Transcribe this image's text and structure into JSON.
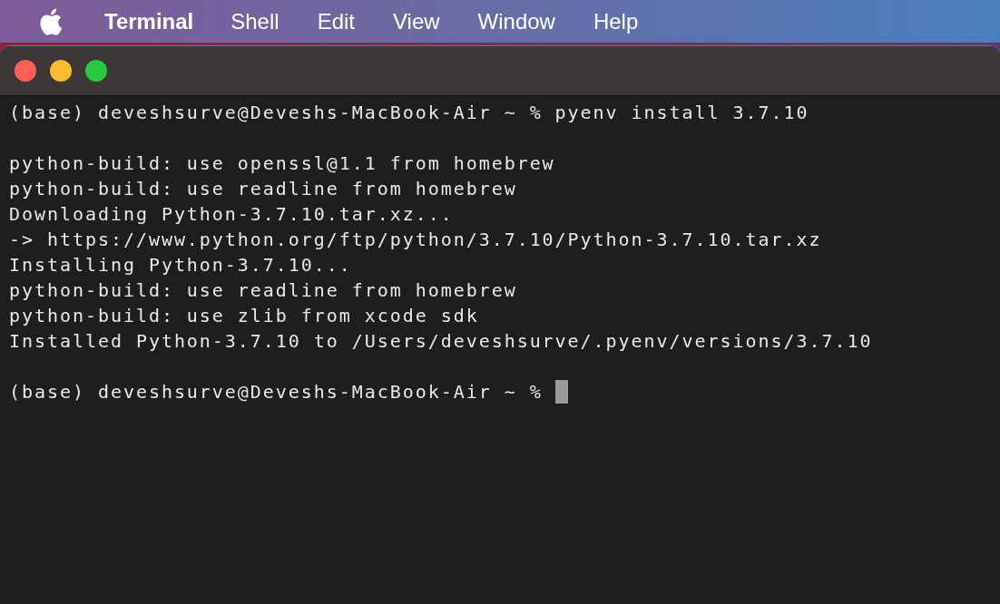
{
  "menu_bar": {
    "app_name": "Terminal",
    "items": [
      "Shell",
      "Edit",
      "View",
      "Window",
      "Help"
    ]
  },
  "terminal": {
    "lines": [
      {
        "kind": "text",
        "text": "(base) deveshsurve@Deveshs-MacBook-Air ~ % pyenv install 3.7.10"
      },
      {
        "kind": "blank"
      },
      {
        "kind": "text",
        "text": "python-build: use openssl@1.1 from homebrew"
      },
      {
        "kind": "text",
        "text": "python-build: use readline from homebrew"
      },
      {
        "kind": "text",
        "text": "Downloading Python-3.7.10.tar.xz..."
      },
      {
        "kind": "text",
        "text": "-> https://www.python.org/ftp/python/3.7.10/Python-3.7.10.tar.xz"
      },
      {
        "kind": "text",
        "text": "Installing Python-3.7.10..."
      },
      {
        "kind": "text",
        "text": "python-build: use readline from homebrew"
      },
      {
        "kind": "text",
        "text": "python-build: use zlib from xcode sdk"
      },
      {
        "kind": "text",
        "text": "Installed Python-3.7.10 to /Users/deveshsurve/.pyenv/versions/3.7.10"
      },
      {
        "kind": "blank"
      },
      {
        "kind": "prompt",
        "text": "(base) deveshsurve@Deveshs-MacBook-Air ~ %",
        "cursor": true
      }
    ]
  }
}
